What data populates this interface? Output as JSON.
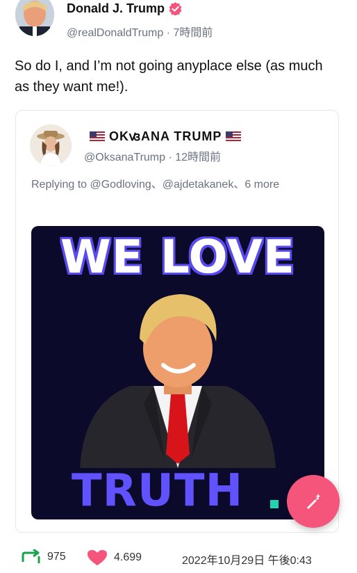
{
  "post": {
    "author_name": "Donald J. Trump",
    "author_handle": "@realDonaldTrump",
    "time_sep": " · ",
    "time_ago": "7時間前",
    "text": "So do I, and I’m not going anyplace else (as much as they want me!)."
  },
  "quote": {
    "author_name": "OKꟃANA TRUMP",
    "author_handle": "@OksanaTrump",
    "time_sep": " · ",
    "time_ago": "12時間前",
    "reply_text": "Replying to @Godloving、@ajdetakanek、6 more",
    "media": {
      "line1": "WE LOVE",
      "line2": "TRUTH"
    }
  },
  "stats": {
    "retruths": "975",
    "likes": "4.699",
    "timestamp": "2022年10月29日 午後0:43"
  },
  "colors": {
    "verified": "#f5557a",
    "fab": "#f5557a",
    "retruth": "#17a34a",
    "like": "#f5557a",
    "media_bg": "#0c0a2b",
    "media_accent": "#6152ff"
  },
  "icons": {
    "verified": "verified-badge-icon",
    "retruth": "retruth-icon",
    "like": "heart-icon",
    "fab": "compose-icon",
    "flag": "us-flag-icon"
  }
}
